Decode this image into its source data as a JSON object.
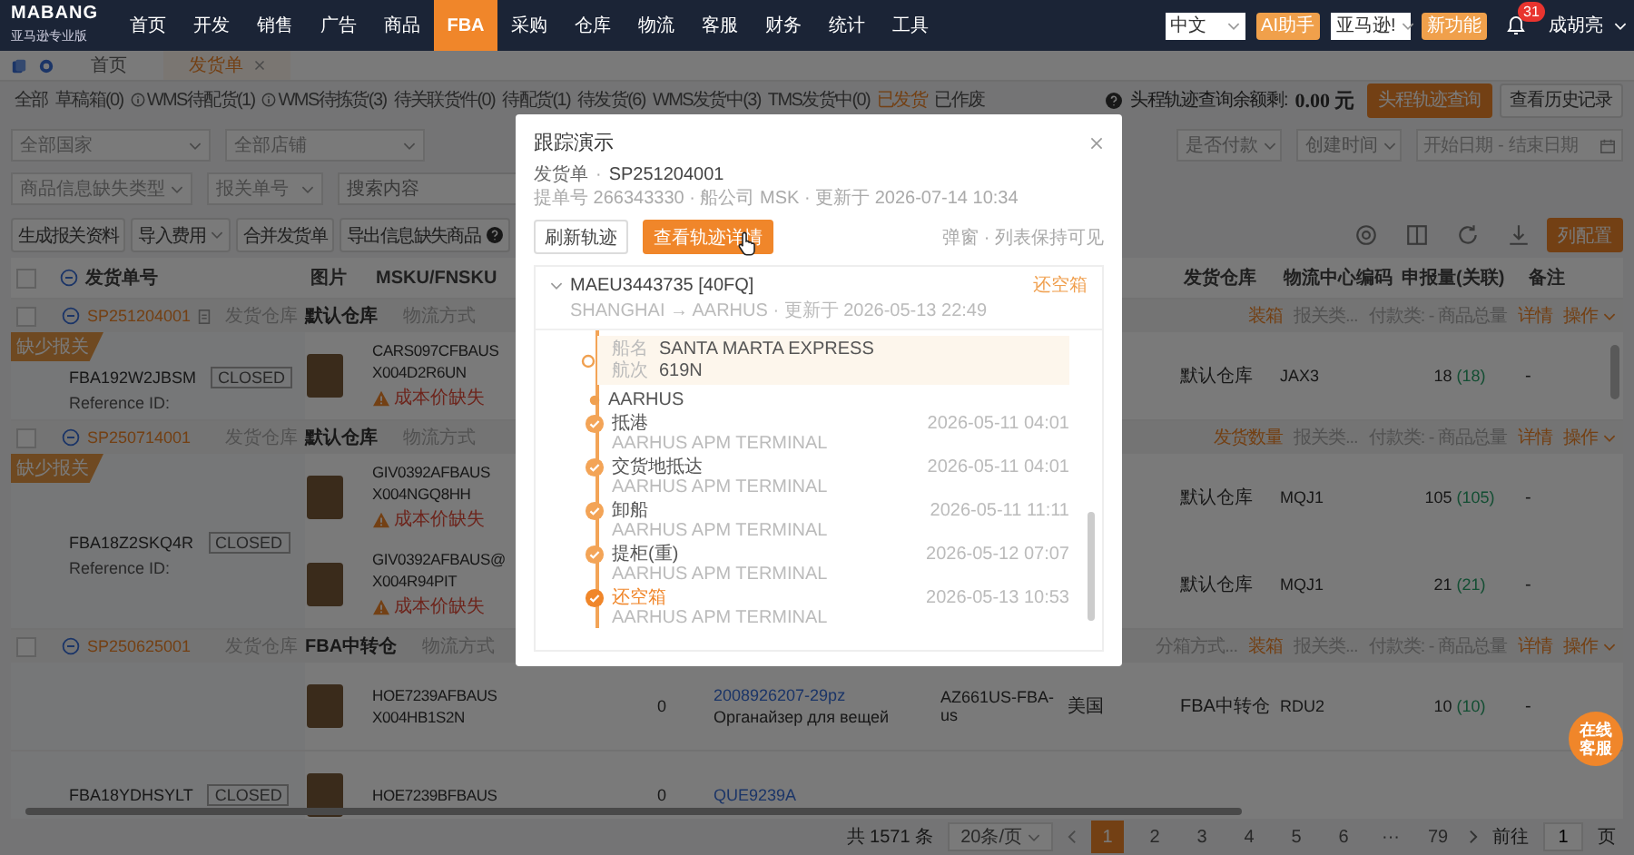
{
  "nav": {
    "logo": "MABANG",
    "logo_sub": "亚马逊专业版",
    "menu": [
      {
        "label": "首页",
        "selected": false
      },
      {
        "label": "开发",
        "selected": false
      },
      {
        "label": "销售",
        "selected": false
      },
      {
        "label": "广告",
        "selected": false
      },
      {
        "label": "商品",
        "selected": false
      },
      {
        "label": "FBA",
        "selected": true
      },
      {
        "label": "采购",
        "selected": false
      },
      {
        "label": "仓库",
        "selected": false
      },
      {
        "label": "物流",
        "selected": false
      },
      {
        "label": "客服",
        "selected": false
      },
      {
        "label": "财务",
        "selected": false
      },
      {
        "label": "统计",
        "selected": false
      },
      {
        "label": "工具",
        "selected": false
      }
    ],
    "language": "中文",
    "ai_button": "AI助手",
    "site": "亚马逊!",
    "new_button": "新功能",
    "notifications": "31",
    "user": "成胡亮"
  },
  "page_tabs": [
    {
      "label": "首页",
      "selected": false,
      "closable": false
    },
    {
      "label": "发货单",
      "selected": true,
      "closable": true
    }
  ],
  "status_tabs": [
    {
      "label": "全部",
      "selected": false,
      "info": false
    },
    {
      "label": "草稿箱(0)",
      "selected": false,
      "info": false
    },
    {
      "label": "WMS待配货(1)",
      "selected": false,
      "info": true
    },
    {
      "label": "WMS待拣货(3)",
      "selected": false,
      "info": true
    },
    {
      "label": "待关联货件(0)",
      "selected": false,
      "info": false
    },
    {
      "label": "待配货(1)",
      "selected": false,
      "info": false
    },
    {
      "label": "待发货(6)",
      "selected": false,
      "info": false
    },
    {
      "label": "WMS发货中(3)",
      "selected": false,
      "info": false
    },
    {
      "label": "TMS发货中(0)",
      "selected": false,
      "info": false
    },
    {
      "label": "已发货",
      "selected": true,
      "info": false
    },
    {
      "label": "已作废",
      "selected": false,
      "info": false
    }
  ],
  "balance": {
    "label": "头程轨迹查询余额剩:",
    "amount": "0.00 元",
    "query_button": "头程轨迹查询",
    "history_button": "查看历史记录"
  },
  "filters": {
    "row_1_left": [
      {
        "kind": "select",
        "value": "全部国家"
      },
      {
        "kind": "select",
        "value": "全部店铺"
      }
    ],
    "row_1_right": [
      {
        "kind": "select",
        "value": "是否付款"
      },
      {
        "kind": "select",
        "value": "创建时间"
      },
      {
        "kind": "date_range",
        "start": "开始日期",
        "separator": "-",
        "end": "结束日期"
      }
    ],
    "row_2": [
      {
        "kind": "select",
        "value": "商品信息缺失类型"
      },
      {
        "kind": "select",
        "value": "报关单号"
      },
      {
        "kind": "search",
        "placeholder": "搜索内容"
      }
    ]
  },
  "actions": {
    "buttons": [
      {
        "label": "生成报关资料",
        "kind": "button"
      },
      {
        "label": "导入费用",
        "kind": "dropdown"
      },
      {
        "label": "合并发货单",
        "kind": "button"
      },
      {
        "label": "导出信息缺失商品",
        "kind": "help"
      }
    ],
    "primary": "列配置"
  },
  "table": {
    "all_checked": false,
    "columns": [
      {
        "kind": "order",
        "label": "发货单号"
      },
      {
        "kind": "img",
        "label": "图片"
      },
      {
        "kind": "msku",
        "label": "MSKU/FNSKU"
      },
      {
        "kind": "wh",
        "label": "发货仓库"
      },
      {
        "kind": "center",
        "label": "物流中心编码"
      },
      {
        "kind": "decl",
        "label": "申报量(关联)"
      },
      {
        "kind": "note",
        "label": "备注"
      }
    ],
    "groups": [
      {
        "checked": false,
        "order_no": "SP251204001",
        "has_note": true,
        "warehouse_label": "发货仓库",
        "warehouse": "默认仓库",
        "shipping_label": "物流方式",
        "tail": [
          {
            "text": "装箱",
            "kind": "accent"
          },
          {
            "text": "报关类...",
            "kind": "muted"
          },
          {
            "text": "付款类: - 商品总量",
            "kind": "muted"
          }
        ],
        "detail": "详情",
        "operate": "操作",
        "shipments": [
          {
            "badge": "缺少报关",
            "fba_id": "FBA192W2JBSM",
            "status": "CLOSED",
            "reference": "Reference ID:",
            "items": [
              {
                "msku": "CARS097CFBAUS",
                "fnsku": "X004D2R6UN",
                "warning": "成本价缺失",
                "warehouse": "默认仓库",
                "center": "JAX3",
                "declared": "18",
                "linked": "(18)",
                "note": "-"
              }
            ]
          }
        ]
      },
      {
        "checked": false,
        "order_no": "SP250714001",
        "has_note": false,
        "warehouse_label": "发货仓库",
        "warehouse": "默认仓库",
        "shipping_label": "物流方式",
        "tail": [
          {
            "text": "发货数量",
            "kind": "accent"
          },
          {
            "text": "报关类...",
            "kind": "muted"
          },
          {
            "text": "付款类: - 商品总量",
            "kind": "muted"
          }
        ],
        "detail": "详情",
        "operate": "操作",
        "shipments": [
          {
            "badge": "缺少报关",
            "fba_id": "FBA18Z2SKQ4R",
            "status": "CLOSED",
            "reference": "Reference ID:",
            "items": [
              {
                "msku": "GIV0392AFBAUS",
                "fnsku": "X004NGQ8HH",
                "warning": "成本价缺失",
                "warehouse": "默认仓库",
                "center": "MQJ1",
                "declared": "105",
                "linked": "(105)",
                "note": "-"
              },
              {
                "msku": "GIV0392AFBAUS@",
                "fnsku": "X004R94PIT",
                "warning": "成本价缺失",
                "warehouse": "默认仓库",
                "center": "MQJ1",
                "declared": "21",
                "linked": "(21)",
                "note": "-"
              }
            ]
          }
        ]
      },
      {
        "checked": false,
        "order_no": "SP250625001",
        "has_note": false,
        "warehouse_label": "发货仓库",
        "warehouse": "FBA中转仓",
        "shipping_label": "物流方式",
        "tail": [
          {
            "text": "分箱方式...",
            "kind": "muted"
          },
          {
            "text": "装箱",
            "kind": "accent"
          },
          {
            "text": "报关类...",
            "kind": "muted"
          },
          {
            "text": "付款类: - 商品总量",
            "kind": "muted"
          }
        ],
        "detail": "详情",
        "operate": "操作",
        "shipments": [
          {
            "items": [
              {
                "msku": "HOE7239AFBAUS",
                "fnsku": "X004HB1S2N",
                "qty": "0",
                "product_link": "2008926207-29pz",
                "product_name": "Органайзер для вещей",
                "az": "AZ661US-FBA-us",
                "country": "美国",
                "warehouse": "FBA中转仓",
                "center": "RDU2",
                "declared": "10",
                "linked": "(10)",
                "note": "-"
              }
            ]
          },
          {
            "fba_id": "FBA18YDHSYLT",
            "status": "CLOSED",
            "items": [
              {
                "msku": "HOE7239BFBAUS",
                "qty": "0",
                "product_link": "QUE9239A"
              }
            ]
          }
        ]
      }
    ]
  },
  "pagination": {
    "total": "共 1571 条",
    "page_size": "20条/页",
    "pages": [
      {
        "label": "1",
        "selected": true
      },
      {
        "label": "2",
        "selected": false
      },
      {
        "label": "3",
        "selected": false
      },
      {
        "label": "4",
        "selected": false
      },
      {
        "label": "5",
        "selected": false
      },
      {
        "label": "6",
        "selected": false
      },
      {
        "label": "···",
        "selected": false
      },
      {
        "label": "79",
        "selected": false
      }
    ],
    "goto_label": "前往",
    "goto_value": "1",
    "goto_suffix": "页"
  },
  "chat_button": "在线客服",
  "modal": {
    "title": "跟踪演示",
    "order_label": "发货单",
    "separator": "·",
    "order_no": "SP251204001",
    "meta": "提单号 266343330 · 船公司 MSK · 更新于 2026-07-14 10:34",
    "refresh_button": "刷新轨迹",
    "detail_button": "查看轨迹详情",
    "hint": "弹窗 · 列表保持可见",
    "container": {
      "number": "MAEU3443735 [40FQ]",
      "route": "SHANGHAI → AARHUS · 更新于 2026-05-13 22:49",
      "status": "还空箱",
      "expanded": true,
      "vessel": {
        "name_label": "船名",
        "name": "SANTA MARTA EXPRESS",
        "voyage_label": "航次",
        "voyage": "619N"
      },
      "location": "AARHUS",
      "events": [
        {
          "name": "抵港",
          "place": "AARHUS APM TERMINAL",
          "time": "2026-05-11 04:01",
          "current": false
        },
        {
          "name": "交货地抵达",
          "place": "AARHUS APM TERMINAL",
          "time": "2026-05-11 04:01",
          "current": false
        },
        {
          "name": "卸船",
          "place": "AARHUS APM TERMINAL",
          "time": "2026-05-11 11:11",
          "current": false
        },
        {
          "name": "提柜(重)",
          "place": "AARHUS APM TERMINAL",
          "time": "2026-05-12 07:07",
          "current": false
        },
        {
          "name": "还空箱",
          "place": "AARHUS APM TERMINAL",
          "time": "2026-05-13 10:53",
          "current": true
        }
      ]
    }
  }
}
